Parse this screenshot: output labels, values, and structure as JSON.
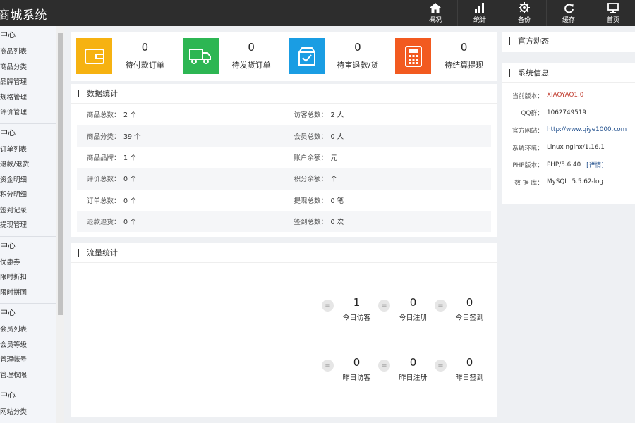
{
  "app": {
    "title": "商城系统"
  },
  "nav": [
    {
      "label": "概况",
      "icon": "home-icon"
    },
    {
      "label": "统计",
      "icon": "bar-chart-icon"
    },
    {
      "label": "备份",
      "icon": "gear-icon"
    },
    {
      "label": "缓存",
      "icon": "refresh-icon"
    },
    {
      "label": "首页",
      "icon": "monitor-icon"
    }
  ],
  "sidebar": {
    "groups": [
      {
        "title": "中心",
        "items": [
          "商品列表",
          "商品分类",
          "品牌管理",
          "规格管理",
          "评价管理"
        ]
      },
      {
        "title": "中心",
        "items": [
          "订单列表",
          "退款/退货",
          "资金明细",
          "积分明细",
          "签到记录",
          "提现管理"
        ]
      },
      {
        "title": "中心",
        "items": [
          "优惠券",
          "限时折扣",
          "限时拼团"
        ]
      },
      {
        "title": "中心",
        "items": [
          "会员列表",
          "会员等级",
          "管理帐号",
          "管理权限"
        ]
      },
      {
        "title": "中心",
        "items": [
          "网站分类"
        ]
      }
    ]
  },
  "cards": [
    {
      "value": "0",
      "label": "待付款订单",
      "color": "#f6b211",
      "icon": "wallet-icon"
    },
    {
      "value": "0",
      "label": "待发货订单",
      "color": "#2db653",
      "icon": "truck-icon"
    },
    {
      "value": "0",
      "label": "待审退款/货",
      "color": "#1a9de3",
      "icon": "box-check-icon"
    },
    {
      "value": "0",
      "label": "待结算提现",
      "color": "#f25a20",
      "icon": "calculator-icon"
    }
  ],
  "stats": {
    "title": "数据统计",
    "rows": [
      {
        "lk": "商品总数：",
        "lv": "2 个",
        "rk": "访客总数：",
        "rv": "2 人"
      },
      {
        "lk": "商品分类：",
        "lv": "39 个",
        "rk": "会员总数：",
        "rv": "0 人"
      },
      {
        "lk": "商品品牌：",
        "lv": "1 个",
        "rk": "账户余额：",
        "rv": "元"
      },
      {
        "lk": "评价总数：",
        "lv": "0 个",
        "rk": "积分余额：",
        "rv": "个"
      },
      {
        "lk": "订单总数：",
        "lv": "0 个",
        "rk": "提现总数：",
        "rv": "0 笔"
      },
      {
        "lk": "退款退货：",
        "lv": "0 个",
        "rk": "签到总数：",
        "rv": "0 次"
      }
    ]
  },
  "traffic": {
    "title": "流量统计",
    "rows": [
      [
        {
          "value": "1",
          "label": "今日访客"
        },
        {
          "value": "0",
          "label": "今日注册"
        },
        {
          "value": "0",
          "label": "今日签到"
        }
      ],
      [
        {
          "value": "0",
          "label": "昨日访客"
        },
        {
          "value": "0",
          "label": "昨日注册"
        },
        {
          "value": "0",
          "label": "昨日签到"
        }
      ]
    ]
  },
  "news": {
    "title": "官方动态"
  },
  "sysinfo": {
    "title": "系统信息",
    "rows": [
      {
        "k": "当前版本：",
        "v": "XIAOYAO1.0",
        "style": "red"
      },
      {
        "k": "QQ群：",
        "v": "1062749519",
        "style": ""
      },
      {
        "k": "官方网站：",
        "v": "http://www.qiye1000.com",
        "style": "blue"
      },
      {
        "k": "系统环境：",
        "v": "Linux nginx/1.16.1",
        "style": ""
      },
      {
        "k": "PHP版本：",
        "v": "PHP/5.6.40",
        "style": "",
        "link": "[详情]"
      },
      {
        "k": "数 据 库：",
        "v": "MySQLi 5.5.62-log",
        "style": ""
      }
    ]
  }
}
